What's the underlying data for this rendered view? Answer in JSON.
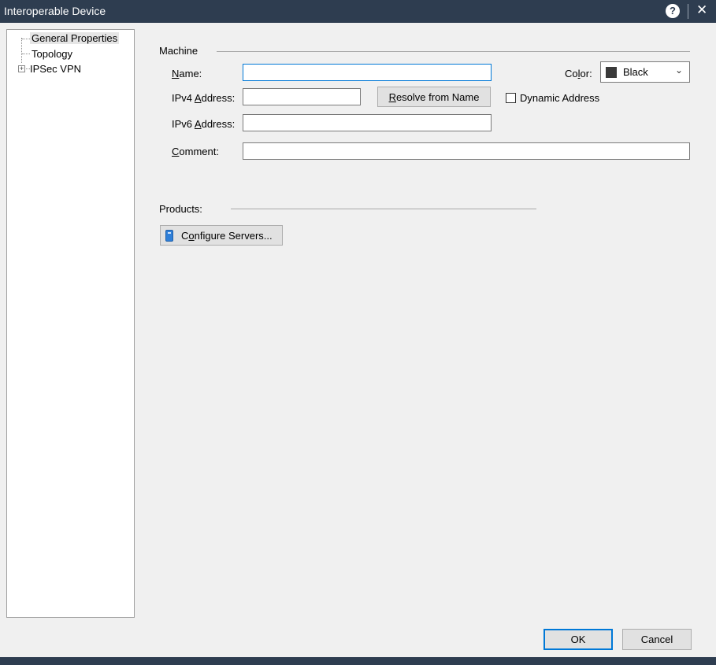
{
  "window": {
    "title": "Interoperable Device",
    "help_label": "?",
    "close_label": "✕"
  },
  "tree": {
    "items": [
      {
        "label": "General Properties",
        "selected": true
      },
      {
        "label": "Topology",
        "selected": false
      },
      {
        "label": "IPSec VPN",
        "selected": false,
        "expandable": true
      }
    ],
    "expander_label": "+"
  },
  "machine": {
    "section_label": "Machine",
    "name": {
      "label_pre": "",
      "label_u": "N",
      "label_post": "ame:",
      "value": ""
    },
    "ipv4": {
      "label_pre": "IPv4 ",
      "label_u": "A",
      "label_post": "ddress:",
      "value": ""
    },
    "ipv6": {
      "label_pre": "IPv6 ",
      "label_u": "A",
      "label_post": "ddress:",
      "value": ""
    },
    "comment": {
      "label_pre": "",
      "label_u": "C",
      "label_post": "omment:",
      "value": ""
    },
    "resolve_button": {
      "pre": "",
      "u": "R",
      "post": "esolve from Name"
    },
    "dynamic_address": {
      "label": "Dynamic Address",
      "checked": false
    },
    "color": {
      "label_pre": "Co",
      "label_u": "l",
      "label_post": "or:",
      "value": "Black",
      "swatch": "#3a3a3a"
    }
  },
  "products": {
    "section_label": "Products:",
    "configure_button": {
      "pre": "C",
      "u": "o",
      "post": "nfigure Servers..."
    }
  },
  "footer": {
    "ok_label": "OK",
    "cancel_label": "Cancel"
  },
  "colors": {
    "titlebar": "#2e3d50",
    "accent": "#0078d7",
    "background": "#f0f0f0"
  }
}
